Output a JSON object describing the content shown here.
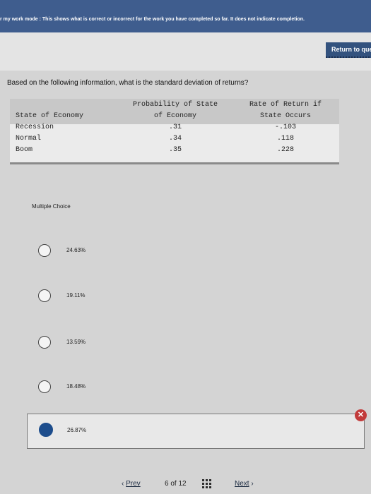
{
  "banner": {
    "text": "r my work mode : This shows what is correct or incorrect for the work you have completed so far. It does not indicate completion."
  },
  "header": {
    "return_label": "Return to que"
  },
  "question": {
    "prompt": "Based on the following information, what is the standard deviation of returns?"
  },
  "table": {
    "headers": {
      "state": "State of Economy",
      "prob_line1": "Probability of State",
      "prob_line2": "of Economy",
      "ret_line1": "Rate of Return if",
      "ret_line2": "State Occurs"
    },
    "rows": [
      {
        "state": "Recession",
        "prob": ".31",
        "ret": "-.103"
      },
      {
        "state": "Normal",
        "prob": ".34",
        "ret": ".118"
      },
      {
        "state": "Boom",
        "prob": ".35",
        "ret": ".228"
      }
    ]
  },
  "choices": {
    "label": "Multiple Choice",
    "options": [
      {
        "text": "24.63%"
      },
      {
        "text": "19.11%"
      },
      {
        "text": "13.59%"
      },
      {
        "text": "18.48%"
      },
      {
        "text": "26.87%"
      }
    ],
    "selected_index": 4,
    "feedback_symbol": "✕"
  },
  "footer": {
    "prev_arrow": "‹",
    "prev_label": "Prev",
    "current_page": "6",
    "of_label": "of",
    "total_pages": "12",
    "next_label": "Next",
    "next_arrow": "›"
  }
}
